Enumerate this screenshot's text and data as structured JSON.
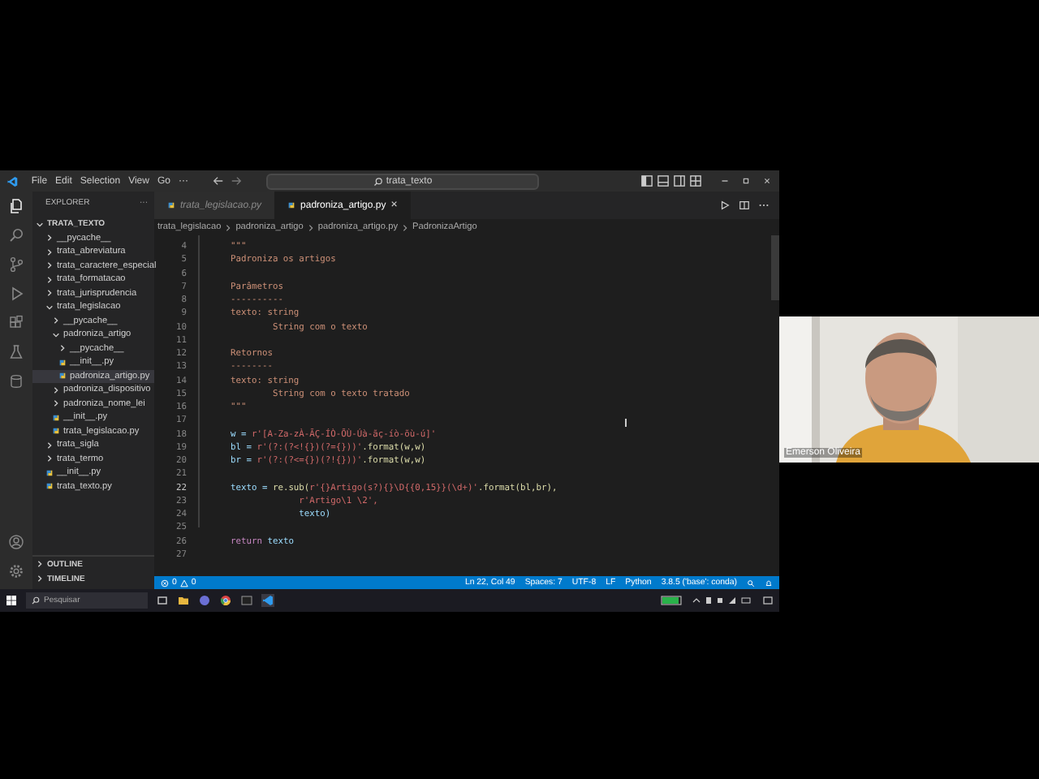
{
  "titlebar": {
    "menus": [
      "File",
      "Edit",
      "Selection",
      "View",
      "Go",
      "···"
    ],
    "search": "trata_texto"
  },
  "explorer": {
    "title": "EXPLORER",
    "more": "···",
    "root": "TRATA_TEXTO",
    "root_expanded": true,
    "items": [
      {
        "label": "__pycache__",
        "kind": "folder",
        "expanded": false,
        "selected": false
      },
      {
        "label": "trata_abreviatura",
        "kind": "folder",
        "expanded": false,
        "selected": false
      },
      {
        "label": "trata_caractere_especial",
        "kind": "folder",
        "expanded": false,
        "selected": false
      },
      {
        "label": "trata_formatacao",
        "kind": "folder",
        "expanded": false,
        "selected": false
      },
      {
        "label": "trata_jurisprudencia",
        "kind": "folder",
        "expanded": false,
        "selected": false
      },
      {
        "label": "trata_legislacao",
        "kind": "folder",
        "expanded": true,
        "selected": false,
        "children": [
          {
            "label": "__pycache__",
            "kind": "folder",
            "expanded": false,
            "selected": false
          },
          {
            "label": "padroniza_artigo",
            "kind": "folder",
            "expanded": true,
            "selected": false,
            "children": [
              {
                "label": "__pycache__",
                "kind": "folder",
                "expanded": false,
                "selected": false
              },
              {
                "label": "__init__.py",
                "kind": "file",
                "selected": false
              },
              {
                "label": "padroniza_artigo.py",
                "kind": "file",
                "selected": true
              }
            ]
          },
          {
            "label": "padroniza_dispositivo",
            "kind": "folder",
            "expanded": false,
            "selected": false
          },
          {
            "label": "padroniza_nome_lei",
            "kind": "folder",
            "expanded": false,
            "selected": false
          },
          {
            "label": "__init__.py",
            "kind": "file",
            "selected": false
          },
          {
            "label": "trata_legislacao.py",
            "kind": "file",
            "selected": false
          }
        ]
      },
      {
        "label": "trata_sigla",
        "kind": "folder",
        "expanded": false,
        "selected": false
      },
      {
        "label": "trata_termo",
        "kind": "folder",
        "expanded": false,
        "selected": false
      },
      {
        "label": "__init__.py",
        "kind": "file",
        "selected": false
      },
      {
        "label": "trata_texto.py",
        "kind": "file",
        "selected": false
      }
    ],
    "sections": [
      {
        "label": "OUTLINE",
        "expanded": false
      },
      {
        "label": "TIMELINE",
        "expanded": false
      }
    ]
  },
  "tabs": [
    {
      "label": "trata_legislacao.py",
      "selected": false,
      "preview": true
    },
    {
      "label": "padroniza_artigo.py",
      "selected": true,
      "preview": false,
      "close": "×"
    }
  ],
  "breadcrumbs": [
    "trata_legislacao",
    "padroniza_artigo",
    "padroniza_artigo.py",
    "PadronizaArtigo"
  ],
  "editor": {
    "lines": [
      {
        "number": "4",
        "current": false,
        "tokens": [
          {
            "text": "    \"\"\"",
            "kind": "doc"
          }
        ]
      },
      {
        "number": "5",
        "current": false,
        "tokens": [
          {
            "text": "    Padroniza os artigos",
            "kind": "doc"
          }
        ]
      },
      {
        "number": "6",
        "current": false
      },
      {
        "number": "7",
        "current": false,
        "tokens": [
          {
            "text": "    Parâmetros",
            "kind": "doc"
          }
        ]
      },
      {
        "number": "8",
        "current": false,
        "tokens": [
          {
            "text": "    ----------",
            "kind": "doc"
          }
        ]
      },
      {
        "number": "9",
        "current": false,
        "tokens": [
          {
            "text": "    texto: string",
            "kind": "doc"
          }
        ]
      },
      {
        "number": "10",
        "current": false,
        "tokens": [
          {
            "text": "            String com o texto",
            "kind": "doc"
          }
        ]
      },
      {
        "number": "11",
        "current": false
      },
      {
        "number": "12",
        "current": false,
        "tokens": [
          {
            "text": "    Retornos",
            "kind": "doc"
          }
        ]
      },
      {
        "number": "13",
        "current": false,
        "tokens": [
          {
            "text": "    --------",
            "kind": "doc"
          }
        ]
      },
      {
        "number": "14",
        "current": false,
        "tokens": [
          {
            "text": "    texto: string",
            "kind": "doc"
          }
        ]
      },
      {
        "number": "15",
        "current": false,
        "tokens": [
          {
            "text": "            String com o texto tratado",
            "kind": "doc"
          }
        ]
      },
      {
        "number": "16",
        "current": false,
        "tokens": [
          {
            "text": "    \"\"\"",
            "kind": "doc"
          }
        ]
      },
      {
        "number": "17",
        "current": false
      },
      {
        "number": "18",
        "current": false,
        "tokens": [
          {
            "text": "    w = ",
            "kind": "var"
          },
          {
            "text": "r'[A-Za-zÀ-ÃÇ-ÍÒ-ÕÙ-Úà-ãç-íò-õù-ú]'",
            "kind": "string"
          }
        ]
      },
      {
        "number": "19",
        "current": false,
        "tokens": [
          {
            "text": "    bl = ",
            "kind": "var"
          },
          {
            "text": "r'(?:(?<!{})(?={}))'",
            "kind": "string"
          },
          {
            "text": ".format(w,w)",
            "kind": "func"
          }
        ]
      },
      {
        "number": "20",
        "current": false,
        "tokens": [
          {
            "text": "    br = ",
            "kind": "var"
          },
          {
            "text": "r'(?:(?<={})(?!{}))'",
            "kind": "string"
          },
          {
            "text": ".format(w,w)",
            "kind": "func"
          }
        ]
      },
      {
        "number": "21",
        "current": false
      },
      {
        "number": "22",
        "current": true,
        "tokens": [
          {
            "text": "    texto = ",
            "kind": "var"
          },
          {
            "text": "re.sub(",
            "kind": "func"
          },
          {
            "text": "r'{}Artigo(s?){}\\D{{0,15}}(\\d+)'",
            "kind": "string"
          },
          {
            "text": ".format(bl,br),",
            "kind": "func"
          }
        ]
      },
      {
        "number": "23",
        "current": false,
        "tokens": [
          {
            "text": "                 r'Artigo\\1 \\2',",
            "kind": "string"
          }
        ]
      },
      {
        "number": "24",
        "current": false,
        "tokens": [
          {
            "text": "                 texto)",
            "kind": "var"
          }
        ]
      },
      {
        "number": "25",
        "current": false
      },
      {
        "number": "26",
        "current": false,
        "tokens": [
          {
            "text": "    return",
            "kind": "keyword"
          },
          {
            "text": " texto",
            "kind": "var"
          }
        ]
      },
      {
        "number": "27",
        "current": false
      }
    ]
  },
  "status_bar": {
    "errors": "0",
    "warnings": "0",
    "items": [
      "Ln 22, Col 49",
      "Spaces: 7",
      "UTF-8",
      "LF",
      "Python",
      "3.8.5 ('base': conda)"
    ]
  },
  "taskbar": {
    "search_placeholder": "Pesquisar"
  },
  "video": {
    "participant_name": "Emerson Oliveira"
  }
}
